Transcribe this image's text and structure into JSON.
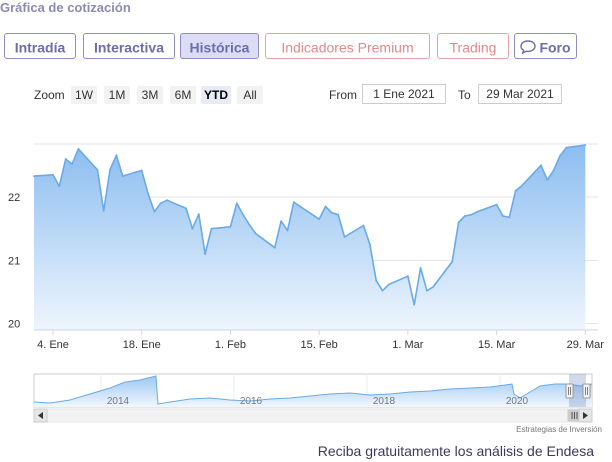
{
  "header": {
    "title": "Gráfica de cotización"
  },
  "tabs": [
    {
      "label": "Intradía"
    },
    {
      "label": "Interactiva"
    },
    {
      "label": "Histórica"
    },
    {
      "label": "Indicadores Premium"
    },
    {
      "label": "Trading"
    },
    {
      "label": "Foro",
      "icon": "chat-bubble-icon"
    }
  ],
  "zoom": {
    "label": "Zoom",
    "buttons": [
      "1W",
      "1M",
      "3M",
      "6M",
      "YTD",
      "All"
    ],
    "selected": "YTD"
  },
  "range": {
    "from_label": "From",
    "from_value": "1 Ene 2021",
    "to_label": "To",
    "to_value": "29 Mar 2021"
  },
  "chart_data": {
    "type": "area",
    "title": "",
    "xlabel": "",
    "ylabel": "",
    "x_tick_labels": [
      "4. Ene",
      "18. Ene",
      "1. Feb",
      "15. Feb",
      "1. Mar",
      "15. Mar",
      "29. Mar"
    ],
    "y_tick_labels": [
      "20",
      "21",
      "22"
    ],
    "ylim": [
      19.9,
      22.9
    ],
    "grid": true,
    "series": [
      {
        "x": [
          "2021-01-01",
          "2021-01-04",
          "2021-01-05",
          "2021-01-06",
          "2021-01-07",
          "2021-01-08",
          "2021-01-11",
          "2021-01-12",
          "2021-01-13",
          "2021-01-14",
          "2021-01-15",
          "2021-01-18",
          "2021-01-19",
          "2021-01-20",
          "2021-01-21",
          "2021-01-22",
          "2021-01-25",
          "2021-01-26",
          "2021-01-27",
          "2021-01-28",
          "2021-01-29",
          "2021-02-01",
          "2021-02-02",
          "2021-02-03",
          "2021-02-04",
          "2021-02-05",
          "2021-02-08",
          "2021-02-09",
          "2021-02-10",
          "2021-02-11",
          "2021-02-12",
          "2021-02-15",
          "2021-02-16",
          "2021-02-17",
          "2021-02-18",
          "2021-02-19",
          "2021-02-22",
          "2021-02-23",
          "2021-02-24",
          "2021-02-25",
          "2021-02-26",
          "2021-03-01",
          "2021-03-02",
          "2021-03-03",
          "2021-03-04",
          "2021-03-05",
          "2021-03-08",
          "2021-03-09",
          "2021-03-10",
          "2021-03-11",
          "2021-03-12",
          "2021-03-15",
          "2021-03-16",
          "2021-03-17",
          "2021-03-18",
          "2021-03-19",
          "2021-03-22",
          "2021-03-23",
          "2021-03-24",
          "2021-03-25",
          "2021-03-26",
          "2021-03-29"
        ],
        "values": [
          22.33,
          22.35,
          22.17,
          22.6,
          22.52,
          22.76,
          22.43,
          21.78,
          22.43,
          22.66,
          22.33,
          22.42,
          22.05,
          21.77,
          21.9,
          21.95,
          21.82,
          21.5,
          21.73,
          21.1,
          21.5,
          21.53,
          21.9,
          21.72,
          21.56,
          21.42,
          21.2,
          21.62,
          21.47,
          21.92,
          21.85,
          21.65,
          21.85,
          21.75,
          21.72,
          21.37,
          21.55,
          21.25,
          20.68,
          20.52,
          20.62,
          20.75,
          20.3,
          20.88,
          20.52,
          20.58,
          20.98,
          21.6,
          21.7,
          21.72,
          21.77,
          21.88,
          21.7,
          21.68,
          22.1,
          22.18,
          22.5,
          22.27,
          22.42,
          22.65,
          22.78,
          22.82
        ]
      }
    ],
    "navigator": {
      "x_tick_labels": [
        "2014",
        "2016",
        "2018",
        "2020"
      ]
    }
  },
  "footer": {
    "source": "Estrategias de Inversión",
    "cta": "Reciba gratuitamente los análisis de Endesa"
  },
  "colors": {
    "line": "#6aaae8",
    "area_top": "#8bbdf0",
    "area_bottom": "#eef5fd",
    "tab_border": "#8f8dc8",
    "tab_premium": "#e38a8a"
  }
}
